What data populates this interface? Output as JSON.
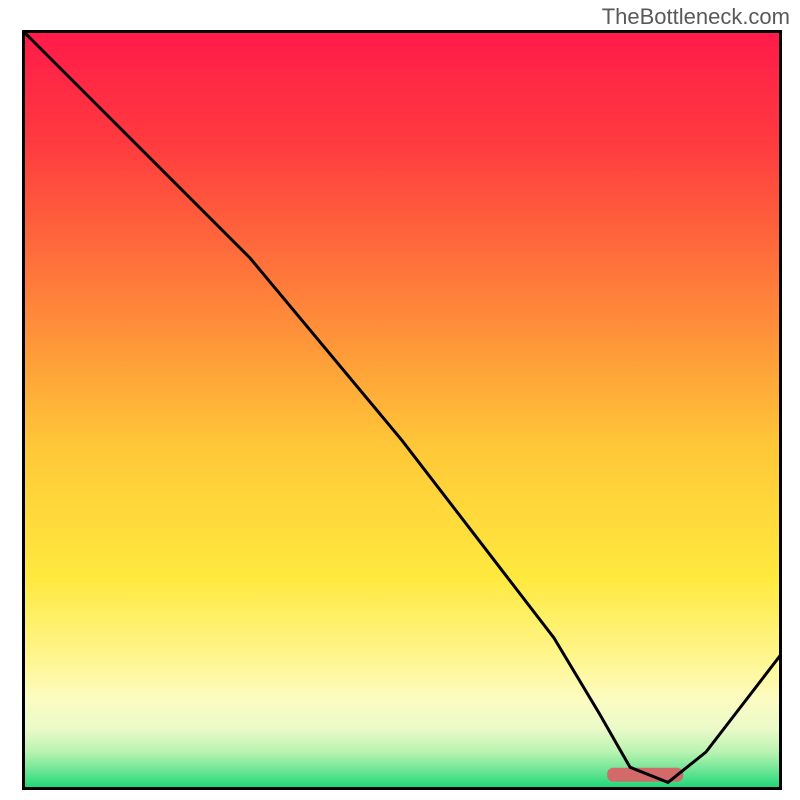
{
  "watermark": "TheBottleneck.com",
  "chart_data": {
    "type": "line",
    "title": "",
    "xlabel": "",
    "ylabel": "",
    "xlim": [
      0,
      100
    ],
    "ylim": [
      0,
      100
    ],
    "gradient_stops": [
      {
        "offset": 0.0,
        "color": "#ff1a4a"
      },
      {
        "offset": 0.15,
        "color": "#ff3b3f"
      },
      {
        "offset": 0.35,
        "color": "#ff803a"
      },
      {
        "offset": 0.55,
        "color": "#ffc838"
      },
      {
        "offset": 0.72,
        "color": "#ffe93e"
      },
      {
        "offset": 0.82,
        "color": "#fff58a"
      },
      {
        "offset": 0.88,
        "color": "#fcfcc0"
      },
      {
        "offset": 0.92,
        "color": "#eafac9"
      },
      {
        "offset": 0.95,
        "color": "#b9f3b0"
      },
      {
        "offset": 0.975,
        "color": "#6be595"
      },
      {
        "offset": 1.0,
        "color": "#12d673"
      }
    ],
    "curve": {
      "x": [
        0,
        10,
        22,
        30,
        40,
        50,
        60,
        70,
        76,
        80,
        85,
        90,
        100
      ],
      "y": [
        100,
        90,
        78,
        70,
        58,
        46,
        33,
        20,
        10,
        3,
        1,
        5,
        18
      ]
    },
    "marker": {
      "x_start": 77,
      "x_end": 87,
      "y": 2,
      "color": "#d36a6a"
    }
  }
}
